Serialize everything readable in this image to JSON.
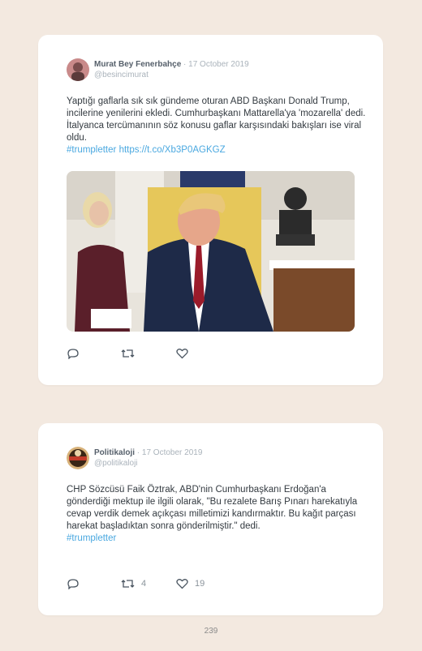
{
  "tweets": [
    {
      "author": "Murat Bey Fenerbahçe",
      "date": "17 October 2019",
      "handle": "@besincimurat",
      "text": "Yaptığı gaflarla sık sık gündeme oturan ABD Başkanı Donald Trump, incilerine yenilerini ekledi. Cumhurbaşkanı Mattarella'ya 'mozarella' dedi. İtalyanca tercümanının söz konusu gaflar karşısındaki bakışları ise viral oldu.",
      "hashtag": "#trumpletter",
      "url": "https://t.co/Xb3P0AGKGZ",
      "actions": {
        "reply_icon": "reply-icon",
        "retweet_icon": "retweet-icon",
        "like_icon": "heart-icon"
      }
    },
    {
      "author": "Politikaloji",
      "date": "17 October 2019",
      "handle": "@politikaloji",
      "text": "CHP Sözcüsü Faik Öztrak, ABD'nin Cumhurbaşkanı Erdoğan'a gönderdiği mektup ile ilgili olarak, \"Bu rezalete Barış Pınarı harekatıyla cevap verdik demek açıkçası milletimizi kandırmaktır. Bu kağıt parçası harekat başladıktan sonra gönderilmiştir.\" dedi.",
      "hashtag": "#trumpletter",
      "retweets": "4",
      "likes": "19",
      "actions": {
        "reply_icon": "reply-icon",
        "retweet_icon": "retweet-icon",
        "like_icon": "heart-icon"
      }
    }
  ],
  "page_number": "239",
  "colors": {
    "background": "#f3e9e0",
    "link": "#4aa8e0",
    "author": "#56606b"
  }
}
